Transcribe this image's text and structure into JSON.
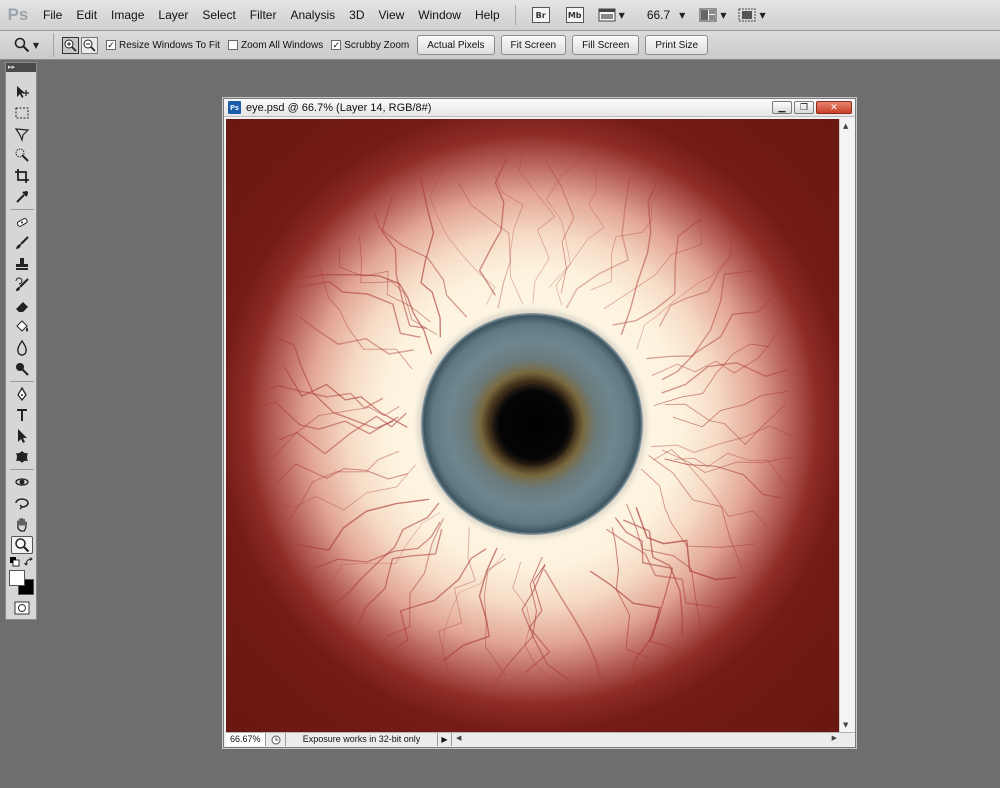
{
  "app": {
    "logo": "Ps",
    "menu": [
      "File",
      "Edit",
      "Image",
      "Layer",
      "Select",
      "Filter",
      "Analysis",
      "3D",
      "View",
      "Window",
      "Help"
    ],
    "bridge_label": "Br",
    "minibridge_label": "Mb",
    "zoom_level": "66.7"
  },
  "options": {
    "resize_windows": {
      "label": "Resize Windows To Fit",
      "checked": true
    },
    "zoom_all": {
      "label": "Zoom All Windows",
      "checked": false
    },
    "scrubby_zoom": {
      "label": "Scrubby Zoom",
      "checked": true
    },
    "buttons": [
      "Actual Pixels",
      "Fit Screen",
      "Fill Screen",
      "Print Size"
    ]
  },
  "document": {
    "icon_label": "Ps",
    "title": "eye.psd @ 66.7% (Layer 14, RGB/8#)",
    "status_zoom": "66.67%",
    "status_text": "Exposure works in 32-bit only"
  },
  "colors": {
    "canvas_bg": "#6a1712",
    "iris": "#6d8790",
    "workspace": "#6e6e6e",
    "close_button": "#c8412a"
  },
  "tools": [
    "move",
    "marquee",
    "lasso",
    "quick-select",
    "crop",
    "eyedropper",
    "spot-heal",
    "brush",
    "clone-stamp",
    "history-brush",
    "eraser",
    "paint-bucket",
    "blur",
    "dodge",
    "pen",
    "type",
    "path-select",
    "shape",
    "3d-rotate",
    "3d-orbit",
    "hand",
    "zoom"
  ]
}
